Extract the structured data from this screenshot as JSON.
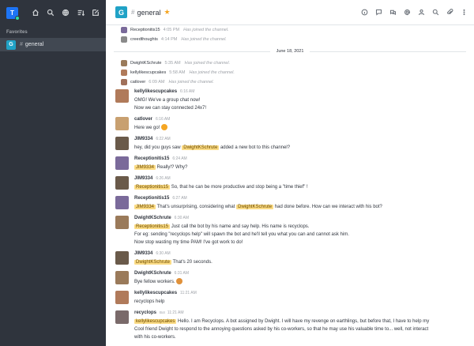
{
  "sidebar": {
    "workspace_initial": "T",
    "section_label": "Favorites",
    "items": [
      {
        "initial": "G",
        "label": "general"
      }
    ]
  },
  "header": {
    "room_initial": "G",
    "room_name": "general"
  },
  "system_messages_top": [
    {
      "user": "Receptionitis15",
      "time": "4:05 PM",
      "text": "Has joined the channel.",
      "color": "#7a6a9a"
    },
    {
      "user": "creedthoughts",
      "time": "4:14 PM",
      "text": "Has joined the channel.",
      "color": "#8a8a8a"
    }
  ],
  "date_divider": "June 18, 2021",
  "system_messages_day": [
    {
      "user": "DwightKSchrute",
      "time": "5:35 AM",
      "text": "Has joined the channel.",
      "color": "#9a7a5a"
    },
    {
      "user": "kellylikescupcakes",
      "time": "5:58 AM",
      "text": "Has joined the channel.",
      "color": "#b07a5a"
    },
    {
      "user": "catlover",
      "time": "6:09 AM",
      "text": "Has joined the channel.",
      "color": "#a0705a"
    }
  ],
  "messages": [
    {
      "user": "kellylikescupcakes",
      "time": "6:16 AM",
      "color": "#b07a5a",
      "lines": [
        [
          "OMG! We've a group chat now!"
        ],
        [
          "Now we can stay connected 24x7!"
        ]
      ]
    },
    {
      "user": "catlover",
      "time": "6:16 AM",
      "color": "#c8a070",
      "lines": [
        [
          "Here we go! "
        ]
      ],
      "emoji": "smile"
    },
    {
      "user": "JIM9334",
      "time": "6:22 AM",
      "color": "#6a5a4a",
      "lines": [
        [
          "hey, did you guys saw ",
          {
            "m": "DwightKSchrute"
          },
          " added a new bot to this channel?"
        ]
      ]
    },
    {
      "user": "Receptionitis15",
      "time": "6:24 AM",
      "color": "#7a6a9a",
      "lines": [
        [
          {
            "m": "JIM9334"
          },
          " Really!? Why?"
        ]
      ]
    },
    {
      "user": "JIM9334",
      "time": "6:26 AM",
      "color": "#6a5a4a",
      "lines": [
        [
          {
            "m": "Receptionitis15"
          },
          " So, that he can be more productive and stop being a \"time thief\" !"
        ]
      ]
    },
    {
      "user": "Receptionitis15",
      "time": "6:27 AM",
      "color": "#7a6a9a",
      "lines": [
        [
          {
            "m": "JIM9334"
          },
          " That's unsurprising, considering what ",
          {
            "m": "DwightKSchrute"
          },
          " had done before. How can we interact with his bot?"
        ]
      ]
    },
    {
      "user": "DwightKSchrute",
      "time": "6:30 AM",
      "color": "#9a7a5a",
      "lines": [
        [
          {
            "m": "Receptionitis15"
          },
          " Just call the bot by his name and say help. His name is recyclops."
        ],
        [
          "For eg: sending \"recyclops help\" will spawn the bot and he'll tell you what you can and cannot ask him."
        ],
        [
          "Now stop wasting my time PAM! I've got work to do!"
        ]
      ]
    },
    {
      "user": "JIM9334",
      "time": "6:30 AM",
      "color": "#6a5a4a",
      "lines": [
        [
          {
            "m": "DwightKSchrute"
          },
          " That's 20 seconds."
        ]
      ]
    },
    {
      "user": "DwightKSchrute",
      "time": "6:31 AM",
      "color": "#9a7a5a",
      "lines": [
        [
          "Bye fellow workers. "
        ]
      ],
      "emoji": "angry"
    },
    {
      "user": "kellylikescupcakes",
      "time": "11:21 AM",
      "color": "#b07a5a",
      "lines": [
        [
          "recyclops help"
        ]
      ]
    },
    {
      "user": "recyclops",
      "tag": "Bot",
      "time": "11:21 AM",
      "color": "#7a6a6a",
      "lines": [
        [
          {
            "m": "kellylikescupcakes"
          },
          " Hello. I am Recyclops. A bot assigned by Dwight. I will have my revenge on earthlings, but before that, I have to help my"
        ],
        [
          "Cool friend Dwight to respond to the annoying questions asked by his co-workers, so that he may use his valuable time to... well, not interact"
        ],
        [
          "with his co-workers."
        ]
      ]
    }
  ]
}
